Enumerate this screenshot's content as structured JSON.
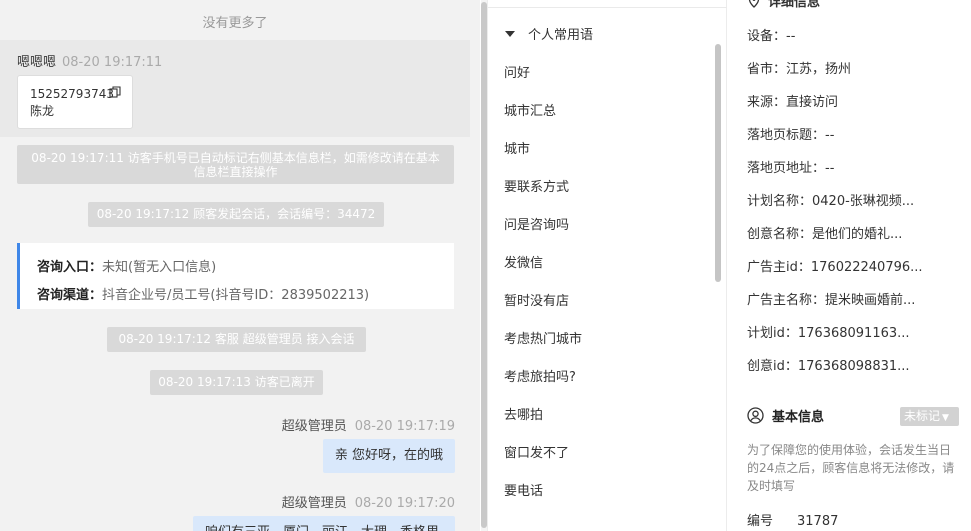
{
  "chat": {
    "no_more": "没有更多了",
    "visitor_msg": {
      "sender": "嗯嗯嗯",
      "time": "08-20 19:17:11",
      "card_line1": "15252793743",
      "card_line2": "陈龙"
    },
    "sys_msgs": [
      "08-20 19:17:11 访客手机号已自动标记右侧基本信息栏，如需修改请在基本信息栏直接操作",
      "08-20 19:17:12 顾客发起会话，会话编号：34472",
      "08-20 19:17:12 客服 超级管理员 接入会话",
      "08-20 19:17:13 访客已离开"
    ],
    "info_card": {
      "entry_label": "咨询入口：",
      "entry_value": "未知(暂无入口信息)",
      "channel_label": "咨询渠道：",
      "channel_value": "抖音企业号/员工号(抖音号ID：2839502213)"
    },
    "agent_msgs": [
      {
        "sender": "超级管理员",
        "time": "08-20 19:17:19",
        "text": "亲 您好呀，在的哦"
      },
      {
        "sender": "超级管理员",
        "time": "08-20 19:17:20",
        "text": "咱们有三亚、厦门、丽江、大理、香格里"
      }
    ]
  },
  "phrases": {
    "group_title": "个人常用语",
    "items": [
      "问好",
      "城市汇总",
      "城市",
      "要联系方式",
      "问是咨询吗",
      "发微信",
      "暂时没有店",
      "考虑热门城市",
      "考虑旅拍吗?",
      "去哪拍",
      "窗口发不了",
      "要电话"
    ]
  },
  "info_panel": {
    "top_partial_title": "详细信息",
    "fields": [
      {
        "label": "设备：",
        "value": "--"
      },
      {
        "label": "省市：",
        "value": "江苏，扬州"
      },
      {
        "label": "来源：",
        "value": "直接访问"
      },
      {
        "label": "落地页标题：",
        "value": "--"
      },
      {
        "label": "落地页地址：",
        "value": "--"
      },
      {
        "label": "计划名称：",
        "value": "0420-张琳视频..."
      },
      {
        "label": "创意名称：",
        "value": "是他们的婚礼..."
      },
      {
        "label": "广告主id：",
        "value": "176022240796..."
      },
      {
        "label": "广告主名称：",
        "value": "提米映画婚前..."
      },
      {
        "label": "计划id：",
        "value": "176368091163..."
      },
      {
        "label": "创意id：",
        "value": "176368098831..."
      }
    ],
    "basic_info_title": "基本信息",
    "tag_label": "未标记",
    "note": "为了保障您的使用体验，会话发生当日的24点之后，顾客信息将无法修改，请及时填写",
    "number_label": "编号",
    "number_value": "31787"
  },
  "colors": {
    "accent": "#3f87e8",
    "agent_bubble": "#d9e8fb",
    "system_msg_bg": "#d9d9d9",
    "tag_bg": "#d2d2d2"
  }
}
